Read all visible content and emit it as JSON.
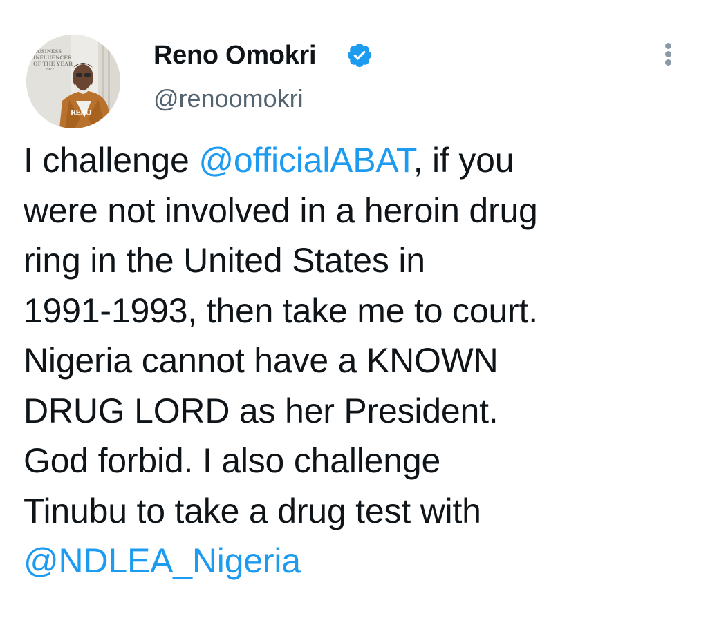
{
  "author": {
    "display_name": "Reno Omokri",
    "handle": "@renoomokri",
    "verified_icon": "verified-badge-icon",
    "avatar_badge": {
      "line1": "BUSINESS",
      "line2": "INFLUENCER",
      "line3": "OF THE YEAR",
      "line4": "2022",
      "logo": "RENO"
    }
  },
  "menu": {
    "icon": "more-options-icon"
  },
  "tweet": {
    "lines": {
      "l1_pre": "I challenge ",
      "l1_mention": "@officialABAT",
      "l1_post": ", if you",
      "l2": "were not involved in a heroin drug",
      "l3": "ring in the United States in",
      "l4": "1991-1993, then take me to court.",
      "l5": "Nigeria cannot have a KNOWN",
      "l6": "DRUG LORD as her President.",
      "l7": "God forbid. I also challenge",
      "l8": "Tinubu to take a drug test with",
      "l9_mention": "@NDLEA_Nigeria"
    }
  },
  "colors": {
    "text": "#0f1419",
    "secondary": "#536471",
    "link": "#1d9bf0",
    "verified": "#1d9bf0"
  }
}
